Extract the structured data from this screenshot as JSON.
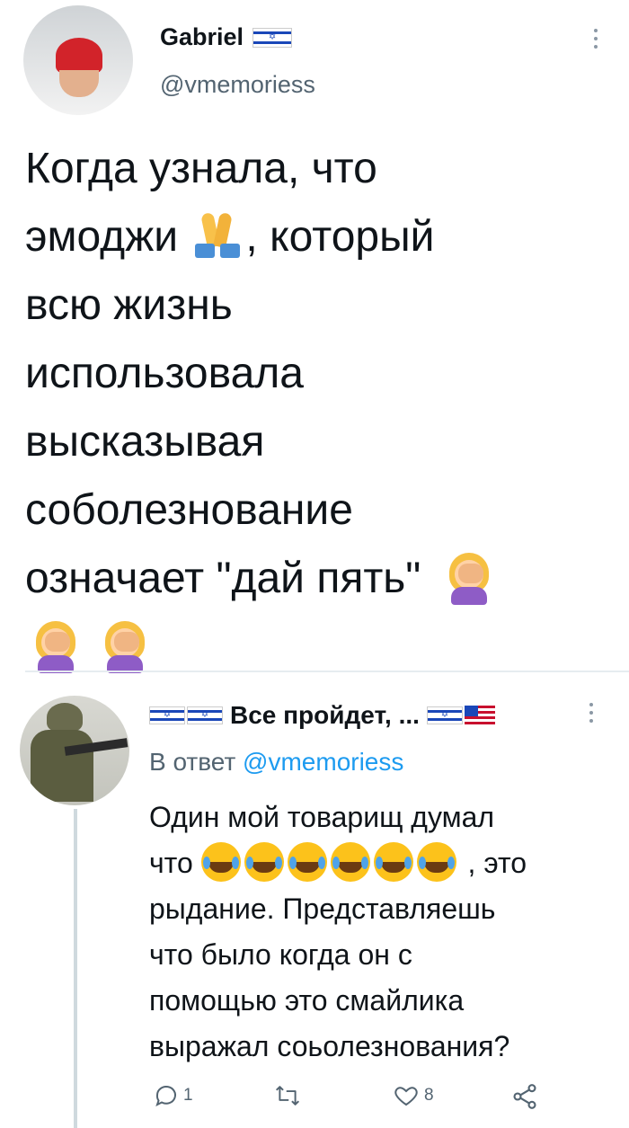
{
  "tweet": {
    "author_name": "Gabriel",
    "author_handle": "@vmemoriess",
    "text_lines": [
      "Когда узнала, что",
      "эмоджи",
      ", который",
      "всю жизнь",
      "использовала",
      "высказывая",
      "соболезнование",
      "означает \"дай пять\""
    ],
    "icons": {
      "name_flag": "israel-flag-icon",
      "menu": "more-vertical-icon",
      "pray": "folded-hands-emoji",
      "facepalm": "woman-facepalming-emoji"
    }
  },
  "reply": {
    "author_name": "Все пройдет, ...",
    "in_reply_label": "В ответ",
    "in_reply_handle": "@vmemoriess",
    "text_line1_a": "Один мой товарищ думал",
    "text_line2_a": "что",
    "text_line2_b": ", это",
    "text_line3": "рыдание. Представляешь",
    "text_line4": "что было когда он с",
    "text_line5": "помощью это смайлика",
    "text_line6": "выражал соьолезнования?",
    "actions": {
      "reply_count": "1",
      "retweet_count": "",
      "like_count": "8"
    },
    "icons": {
      "laugh": "face-with-tears-of-joy-emoji",
      "us_flag": "usa-flag-icon"
    }
  },
  "colors": {
    "link": "#1d9bf0",
    "text": "#0f1419",
    "muted": "#536471",
    "divider": "#e6ecf0"
  }
}
